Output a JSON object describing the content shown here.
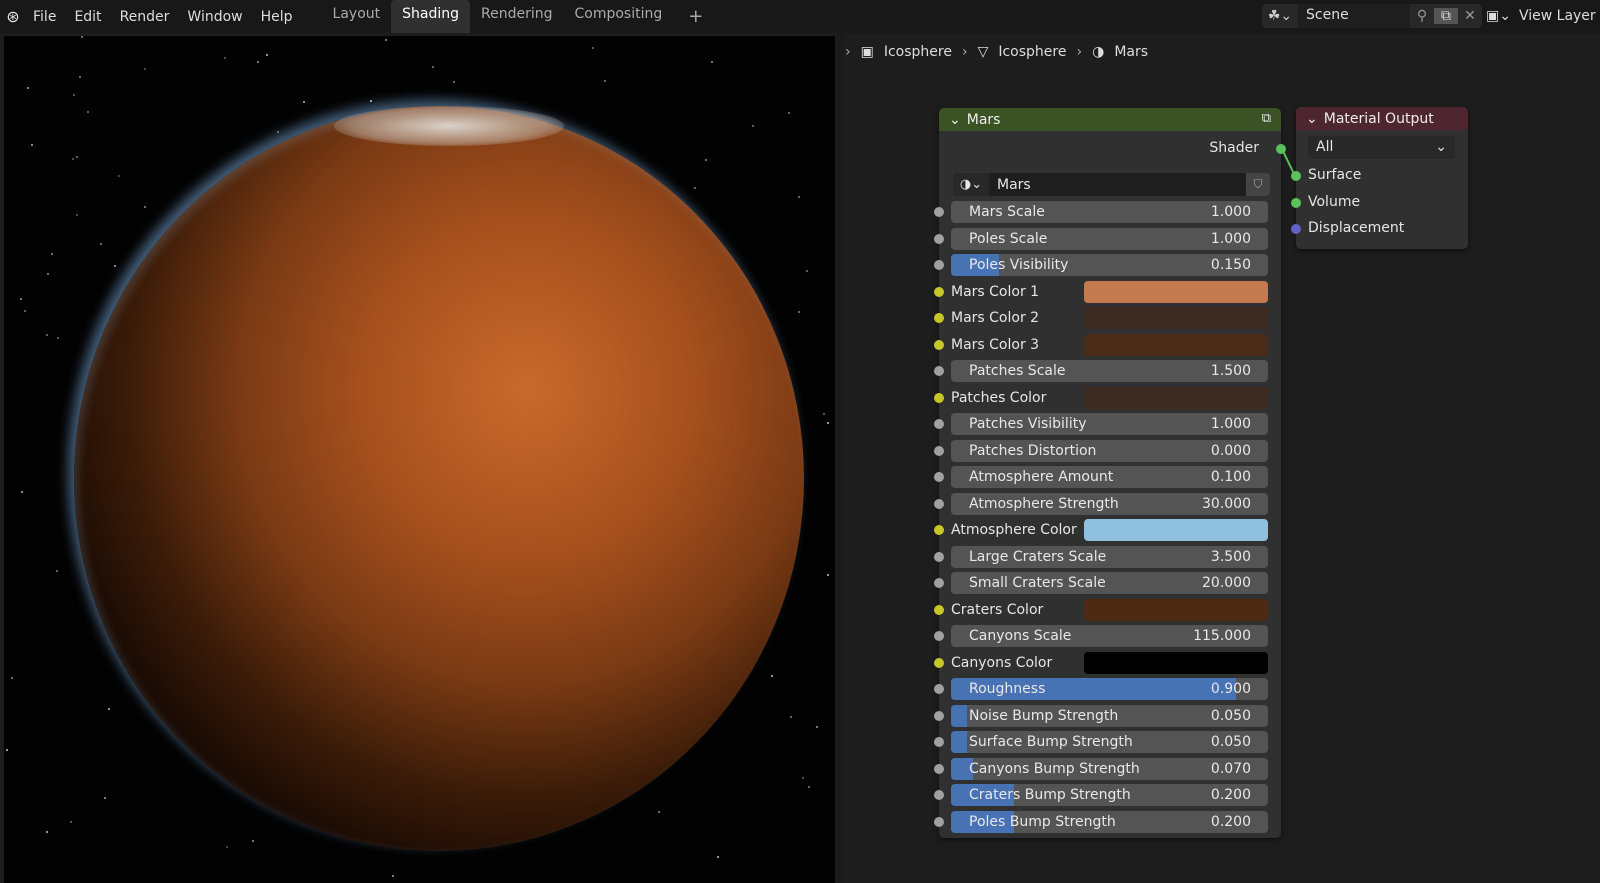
{
  "topbar": {
    "menus": [
      "File",
      "Edit",
      "Render",
      "Window",
      "Help"
    ],
    "tabs": [
      "Layout",
      "Shading",
      "Rendering",
      "Compositing"
    ],
    "active_tab": "Shading",
    "add_tab": "+",
    "scene": "Scene",
    "view_layer": "View Layer"
  },
  "breadcrumb": [
    "Icosphere",
    "Icosphere",
    "Mars"
  ],
  "node": {
    "title": "Mars",
    "output": "Shader",
    "material": "Mars",
    "header_color": "#3b5324",
    "rows": [
      {
        "type": "value",
        "label": "Mars Scale",
        "value": "1.000"
      },
      {
        "type": "value",
        "label": "Poles Scale",
        "value": "1.000"
      },
      {
        "type": "value",
        "label": "Poles Visibility",
        "value": "0.150",
        "fraction": 0.15
      },
      {
        "type": "color",
        "label": "Mars Color 1",
        "color": "#c47a4f"
      },
      {
        "type": "color",
        "label": "Mars Color 2",
        "color": "#3d2a20"
      },
      {
        "type": "color",
        "label": "Mars Color 3",
        "color": "#4a2c18"
      },
      {
        "type": "value",
        "label": "Patches Scale",
        "value": "1.500"
      },
      {
        "type": "color",
        "label": "Patches Color",
        "color": "#3e2b22"
      },
      {
        "type": "value",
        "label": "Patches Visibility",
        "value": "1.000"
      },
      {
        "type": "value",
        "label": "Patches Distortion",
        "value": "0.000"
      },
      {
        "type": "value",
        "label": "Atmosphere Amount",
        "value": "0.100"
      },
      {
        "type": "value",
        "label": "Atmosphere Strength",
        "value": "30.000"
      },
      {
        "type": "color",
        "label": "Atmosphere Color",
        "color": "#8fc0e0"
      },
      {
        "type": "value",
        "label": "Large Craters Scale",
        "value": "3.500"
      },
      {
        "type": "value",
        "label": "Small Craters Scale",
        "value": "20.000"
      },
      {
        "type": "color",
        "label": "Craters Color",
        "color": "#4f2a12"
      },
      {
        "type": "value",
        "label": "Canyons Scale",
        "value": "115.000"
      },
      {
        "type": "color",
        "label": "Canyons Color",
        "color": "#000000"
      },
      {
        "type": "value",
        "label": "Roughness",
        "value": "0.900",
        "fraction": 0.9
      },
      {
        "type": "value",
        "label": "Noise Bump Strength",
        "value": "0.050",
        "fraction": 0.05
      },
      {
        "type": "value",
        "label": "Surface Bump Strength",
        "value": "0.050",
        "fraction": 0.05
      },
      {
        "type": "value",
        "label": "Canyons Bump Strength",
        "value": "0.070",
        "fraction": 0.07
      },
      {
        "type": "value",
        "label": "Craters Bump Strength",
        "value": "0.200",
        "fraction": 0.2
      },
      {
        "type": "value",
        "label": "Poles Bump Strength",
        "value": "0.200",
        "fraction": 0.2
      }
    ]
  },
  "output_node": {
    "title": "Material Output",
    "target": "All",
    "inputs": [
      "Surface",
      "Volume",
      "Displacement"
    ],
    "header_color": "#4e2630"
  }
}
